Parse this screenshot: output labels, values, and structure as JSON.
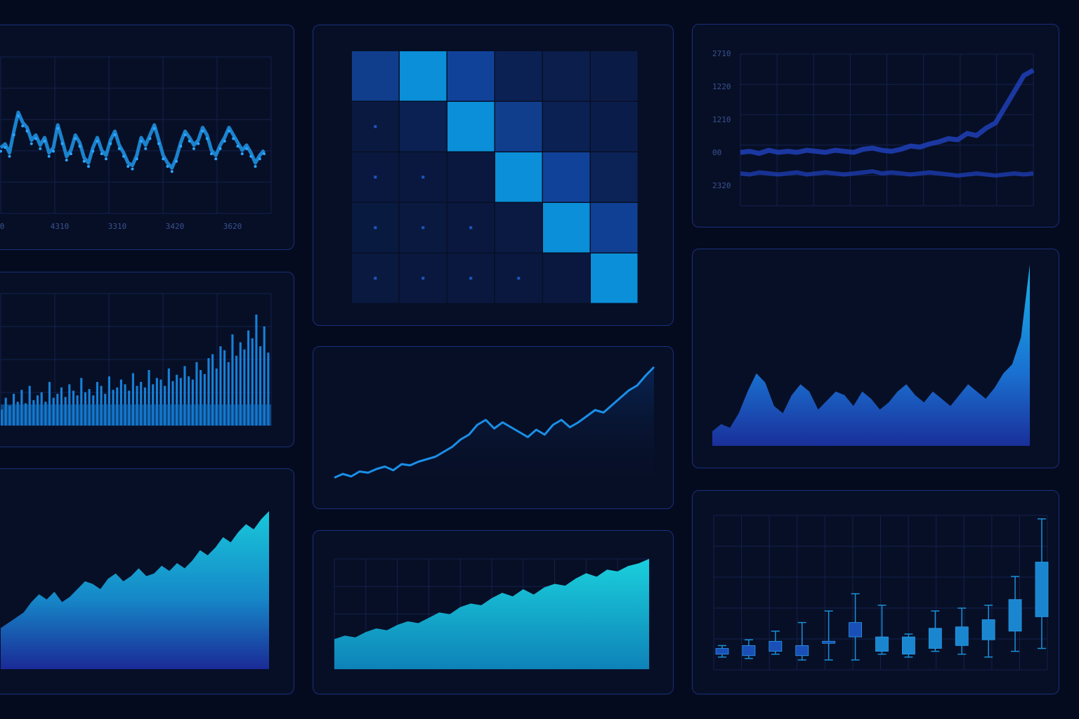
{
  "colors": {
    "background": "#050b1f",
    "panel": "#070f26",
    "border": "#1a2f7a",
    "line": "#1e8fe0",
    "accent_cyan": "#1ac0d6",
    "deep_blue": "#1a2f9a"
  },
  "chart_data": [
    {
      "id": "p1",
      "type": "line",
      "x_tick_labels": [
        "0",
        "4310",
        "3310",
        "3420",
        "3620"
      ],
      "ylim": [
        0,
        100
      ],
      "series": [
        {
          "values": [
            42,
            45,
            38,
            55,
            70,
            62,
            58,
            48,
            52,
            44,
            50,
            38,
            42,
            60,
            48,
            35,
            40,
            52,
            46,
            34,
            30,
            42,
            50,
            40,
            36,
            48,
            55,
            44,
            38,
            30,
            28,
            36,
            50,
            44,
            52,
            60,
            48,
            36,
            30,
            26,
            34,
            46,
            55,
            50,
            44,
            48,
            58,
            52,
            40,
            36,
            44,
            50,
            58,
            52,
            46,
            40,
            44,
            38,
            30,
            36,
            40
          ]
        }
      ],
      "grid": true
    },
    {
      "id": "p2",
      "type": "heatmap",
      "rows": 5,
      "cols": 6,
      "values": [
        [
          0.35,
          1.0,
          0.45,
          0.25,
          0.18,
          0.12
        ],
        [
          0.05,
          0.25,
          1.0,
          0.35,
          0.25,
          0.15
        ],
        [
          0.04,
          0.04,
          0.04,
          1.0,
          0.45,
          0.3
        ],
        [
          0.06,
          0.05,
          0.04,
          0.08,
          0.95,
          0.4
        ],
        [
          0.05,
          0.04,
          0.04,
          0.04,
          0.04,
          0.9
        ]
      ]
    },
    {
      "id": "p3",
      "type": "line",
      "y_tick_labels": [
        "2710",
        "1220",
        "1210",
        "00",
        "2320"
      ],
      "series": [
        {
          "values": [
            12,
            13,
            11,
            14,
            12,
            13,
            12,
            14,
            13,
            12,
            14,
            13,
            12,
            15,
            16,
            14,
            13,
            15,
            18,
            17,
            20,
            22,
            25,
            24,
            30,
            28,
            35,
            40,
            55,
            70,
            85,
            90
          ]
        },
        {
          "values": [
            -8,
            -9,
            -7,
            -8,
            -9,
            -8,
            -7,
            -9,
            -8,
            -7,
            -8,
            -9,
            -8,
            -7,
            -6,
            -8,
            -7,
            -8,
            -9,
            -8,
            -7,
            -8,
            -9,
            -10,
            -9,
            -8,
            -9,
            -10,
            -9,
            -8,
            -9,
            -8
          ]
        }
      ],
      "grid": true
    },
    {
      "id": "p4",
      "type": "bar",
      "values": [
        20,
        35,
        25,
        40,
        30,
        45,
        28,
        50,
        32,
        38,
        42,
        30,
        55,
        35,
        40,
        48,
        36,
        52,
        44,
        38,
        60,
        42,
        46,
        38,
        55,
        50,
        40,
        62,
        45,
        48,
        58,
        52,
        44,
        66,
        50,
        55,
        48,
        70,
        52,
        60,
        58,
        50,
        72,
        56,
        64,
        60,
        75,
        62,
        58,
        80,
        70,
        65,
        85,
        90,
        72,
        100,
        95,
        80,
        115,
        88,
        105,
        96,
        120,
        110,
        140,
        100,
        125,
        92
      ]
    },
    {
      "id": "p5",
      "type": "line",
      "ylim": [
        0,
        100
      ],
      "series": [
        {
          "values": [
            5,
            8,
            6,
            10,
            9,
            12,
            14,
            11,
            16,
            15,
            18,
            20,
            22,
            26,
            30,
            36,
            40,
            48,
            52,
            45,
            50,
            46,
            42,
            38,
            44,
            40,
            48,
            52,
            46,
            50,
            55,
            60,
            58,
            64,
            70,
            76,
            80,
            88,
            95
          ]
        }
      ]
    },
    {
      "id": "p6",
      "type": "area",
      "ylim": [
        0,
        100
      ],
      "series": [
        {
          "values": [
            8,
            12,
            10,
            18,
            30,
            40,
            35,
            22,
            18,
            28,
            34,
            30,
            20,
            25,
            30,
            28,
            22,
            30,
            26,
            20,
            24,
            30,
            34,
            28,
            24,
            30,
            26,
            22,
            28,
            34,
            30,
            26,
            32,
            40,
            45,
            60,
            100
          ]
        }
      ]
    },
    {
      "id": "p7",
      "type": "area",
      "ylim": [
        0,
        100
      ],
      "series": [
        {
          "values": [
            10,
            14,
            12,
            18,
            22,
            20,
            26,
            30,
            28,
            34,
            40,
            38,
            46,
            50,
            48,
            56,
            62,
            58,
            66,
            60,
            68,
            72,
            70,
            78,
            84,
            80,
            88,
            86,
            92,
            95,
            100
          ]
        }
      ]
    },
    {
      "id": "p8",
      "type": "area",
      "ylim": [
        0,
        100
      ],
      "series": [
        {
          "values": [
            10,
            14,
            18,
            22,
            30,
            36,
            32,
            38,
            30,
            34,
            40,
            46,
            44,
            40,
            48,
            52,
            46,
            50,
            56,
            50,
            52,
            58,
            54,
            60,
            56,
            62,
            70,
            66,
            72,
            80,
            76,
            84,
            90,
            86,
            94,
            100
          ]
        }
      ]
    },
    {
      "id": "p9",
      "type": "box",
      "ylim": [
        0,
        100
      ],
      "boxes": [
        {
          "min": 4,
          "q1": 6,
          "q3": 10,
          "max": 12
        },
        {
          "min": 3,
          "q1": 5,
          "q3": 12,
          "max": 16
        },
        {
          "min": 6,
          "q1": 8,
          "q3": 15,
          "max": 22
        },
        {
          "min": 2,
          "q1": 5,
          "q3": 12,
          "max": 28
        },
        {
          "min": 2,
          "q1": 14,
          "q3": 15,
          "max": 36
        },
        {
          "min": 2,
          "q1": 18,
          "q3": 28,
          "max": 48
        },
        {
          "min": 6,
          "q1": 8,
          "q3": 18,
          "max": 40
        },
        {
          "min": 4,
          "q1": 6,
          "q3": 18,
          "max": 20
        },
        {
          "min": 8,
          "q1": 10,
          "q3": 24,
          "max": 36
        },
        {
          "min": 6,
          "q1": 12,
          "q3": 25,
          "max": 38
        },
        {
          "min": 4,
          "q1": 16,
          "q3": 30,
          "max": 40
        },
        {
          "min": 8,
          "q1": 22,
          "q3": 44,
          "max": 60
        },
        {
          "min": 10,
          "q1": 32,
          "q3": 70,
          "max": 100
        }
      ]
    }
  ]
}
